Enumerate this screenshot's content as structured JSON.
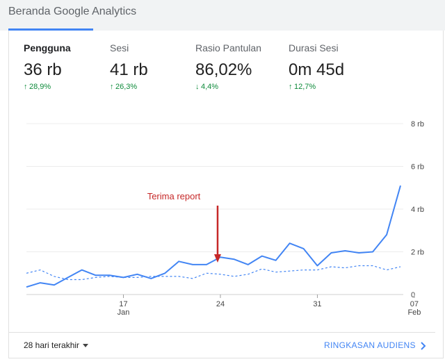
{
  "header": {
    "title": "Beranda Google Analytics"
  },
  "metrics": [
    {
      "label": "Pengguna",
      "value": "36 rb",
      "change": "28,9%",
      "direction": "up"
    },
    {
      "label": "Sesi",
      "value": "41 rb",
      "change": "26,3%",
      "direction": "up"
    },
    {
      "label": "Rasio Pantulan",
      "value": "86,02%",
      "change": "4,4%",
      "direction": "down"
    },
    {
      "label": "Durasi Sesi",
      "value": "0m 45d",
      "change": "12,7%",
      "direction": "up"
    }
  ],
  "annotation": {
    "text": "Terima report"
  },
  "footer": {
    "range_label": "28 hari terakhir",
    "audience_link": "RINGKASAN AUDIENS"
  },
  "colors": {
    "accent": "#4285f4",
    "positive": "#0d8a3a",
    "annotation": "#c62828"
  },
  "icons": {
    "up": "arrow-up-icon",
    "down": "arrow-down-icon",
    "dropdown": "caret-down-icon",
    "link": "chevron-right-icon"
  },
  "chart_data": {
    "type": "line",
    "y_ticks": [
      "8 rb",
      "6 rb",
      "4 rb",
      "2 rb",
      "0"
    ],
    "ylim": [
      0,
      8000
    ],
    "x_tick_labels": [
      {
        "top": "17",
        "bottom": "Jan"
      },
      {
        "top": "24",
        "bottom": ""
      },
      {
        "top": "31",
        "bottom": ""
      },
      {
        "top": "07",
        "bottom": "Feb"
      }
    ],
    "x_tick_days": [
      7,
      14,
      21,
      28
    ],
    "grid": true,
    "annotation_day": 14,
    "series": [
      {
        "style": "solid",
        "color": "#4285f4",
        "values": [
          350,
          550,
          450,
          800,
          1150,
          900,
          900,
          800,
          950,
          750,
          1000,
          1550,
          1400,
          1400,
          1750,
          1650,
          1400,
          1800,
          1600,
          2400,
          2150,
          1350,
          1950,
          2050,
          1950,
          2000,
          2800,
          5100
        ]
      },
      {
        "style": "dashed",
        "color": "#4285f4",
        "values": [
          1000,
          1150,
          850,
          700,
          700,
          800,
          850,
          800,
          800,
          850,
          850,
          850,
          750,
          1000,
          950,
          850,
          950,
          1200,
          1050,
          1100,
          1150,
          1150,
          1300,
          1250,
          1350,
          1350,
          1150,
          1300
        ]
      }
    ]
  }
}
